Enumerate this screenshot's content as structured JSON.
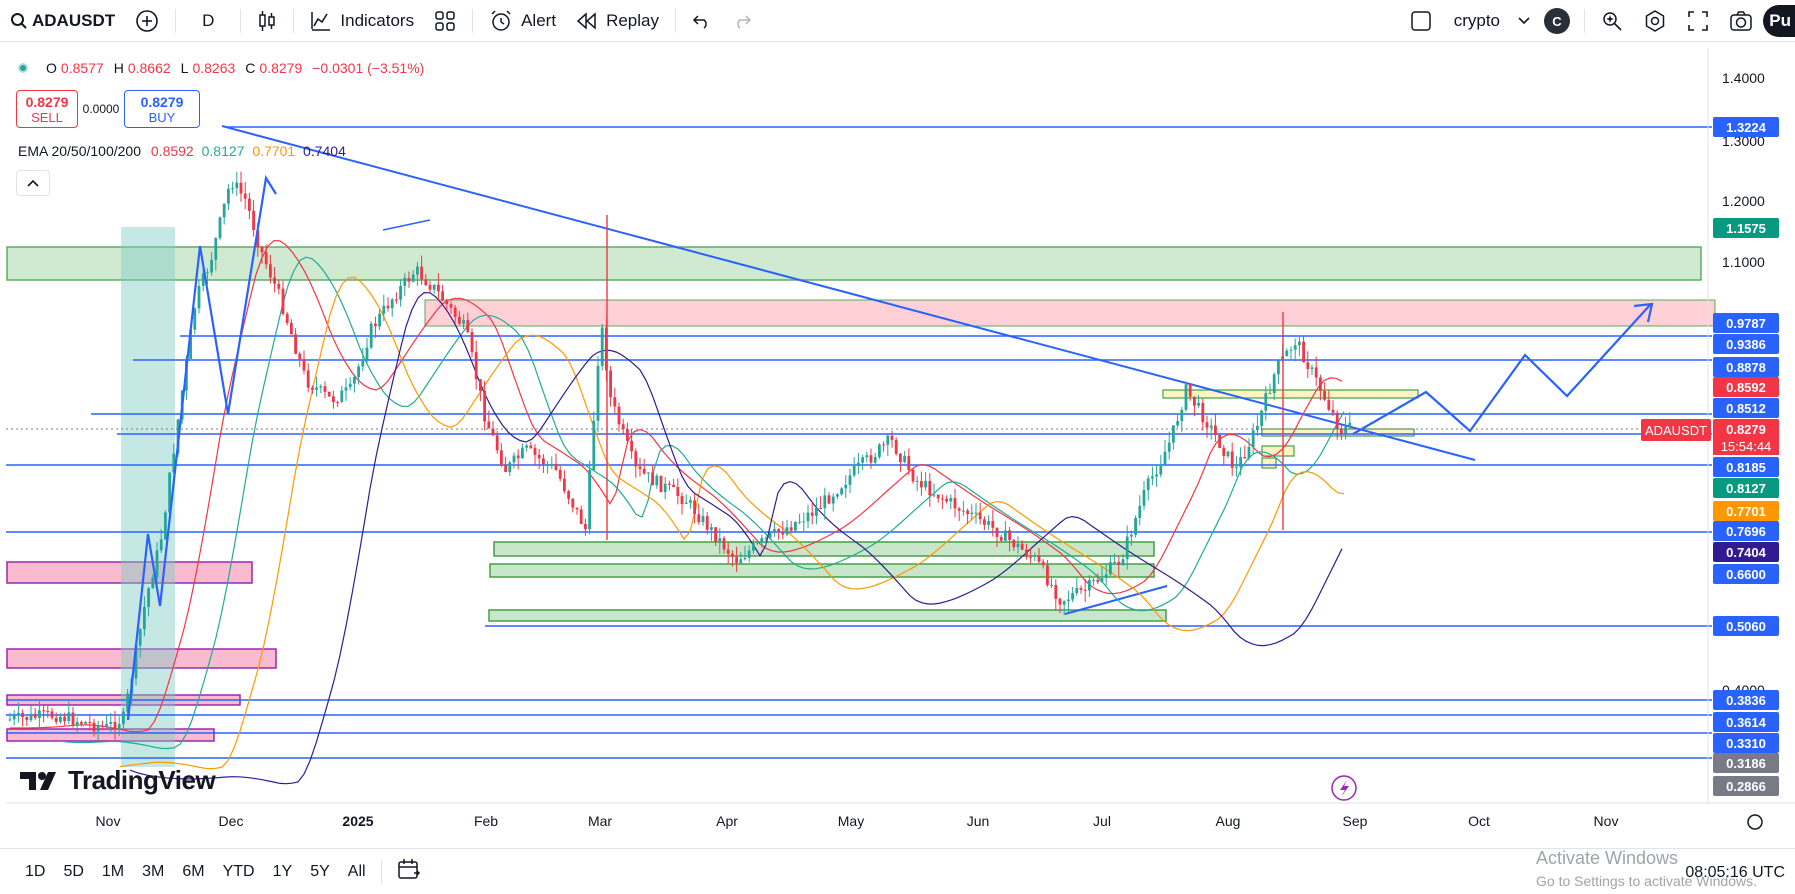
{
  "toolbar": {
    "symbol": "ADAUSDT",
    "interval": "D",
    "indicators_label": "Indicators",
    "alert_label": "Alert",
    "replay_label": "Replay",
    "layout_name": "crypto",
    "badge": "C",
    "publish": "Pu"
  },
  "legend": {
    "open_label": "O",
    "open": "0.8577",
    "high_label": "H",
    "high": "0.8662",
    "low_label": "L",
    "low": "0.8263",
    "close_label": "C",
    "close": "0.8279",
    "change": "−0.0301 (−3.51%)",
    "sell_price": "0.8279",
    "sell_label": "SELL",
    "spread": "0.0000",
    "buy_price": "0.8279",
    "buy_label": "BUY",
    "ema_label": "EMA 20/50/100/200",
    "ema20": "0.8592",
    "ema50": "0.8127",
    "ema100": "0.7701",
    "ema200": "0.7404"
  },
  "colors": {
    "up": "#26a69a",
    "down": "#f23645",
    "line": "#2962ff",
    "ema20": "#f23645",
    "ema50": "#22ab94",
    "ema100": "#ff9800",
    "ema200": "#311b92"
  },
  "price_axis": {
    "plain_ticks": [
      "1.4000",
      "1.3000",
      "1.2000",
      "1.1000",
      "0.4000"
    ],
    "labels": [
      {
        "text": "1.3224",
        "color": "#2962ff"
      },
      {
        "text": "1.1575",
        "color": "#089981"
      },
      {
        "text": "0.9787",
        "color": "#2962ff"
      },
      {
        "text": "0.9386",
        "color": "#2962ff"
      },
      {
        "text": "0.8878",
        "color": "#2962ff"
      },
      {
        "text": "0.8592",
        "color": "#f23645"
      },
      {
        "text": "0.8512",
        "color": "#2962ff"
      },
      {
        "text": "0.8279",
        "color": "#f23645"
      },
      {
        "text": "0.8185",
        "color": "#2962ff"
      },
      {
        "text": "0.8127",
        "color": "#089981"
      },
      {
        "text": "0.7701",
        "color": "#ff9800"
      },
      {
        "text": "0.7696",
        "color": "#2962ff"
      },
      {
        "text": "0.7404",
        "color": "#311b92"
      },
      {
        "text": "0.6600",
        "color": "#2962ff"
      },
      {
        "text": "0.5060",
        "color": "#2962ff"
      },
      {
        "text": "0.3836",
        "color": "#2962ff"
      },
      {
        "text": "0.3614",
        "color": "#2962ff"
      },
      {
        "text": "0.3310",
        "color": "#2962ff"
      },
      {
        "text": "0.3186",
        "color": "#787b86"
      },
      {
        "text": "0.2866",
        "color": "#787b86"
      }
    ],
    "symbol_tag": "ADAUSDT",
    "countdown": "15:54:44"
  },
  "time_axis": [
    "Nov",
    "Dec",
    "2025",
    "Feb",
    "Mar",
    "Apr",
    "May",
    "Jun",
    "Jul",
    "Aug",
    "Sep",
    "Oct",
    "Nov"
  ],
  "brand": "TradingView",
  "bottom": {
    "ranges": [
      "1D",
      "5D",
      "1M",
      "3M",
      "6M",
      "YTD",
      "1Y",
      "5Y",
      "All"
    ],
    "clock": "08:05:16 UTC",
    "activate_title": "Activate Windows",
    "activate_sub": "Go to Settings to activate Windows."
  }
}
